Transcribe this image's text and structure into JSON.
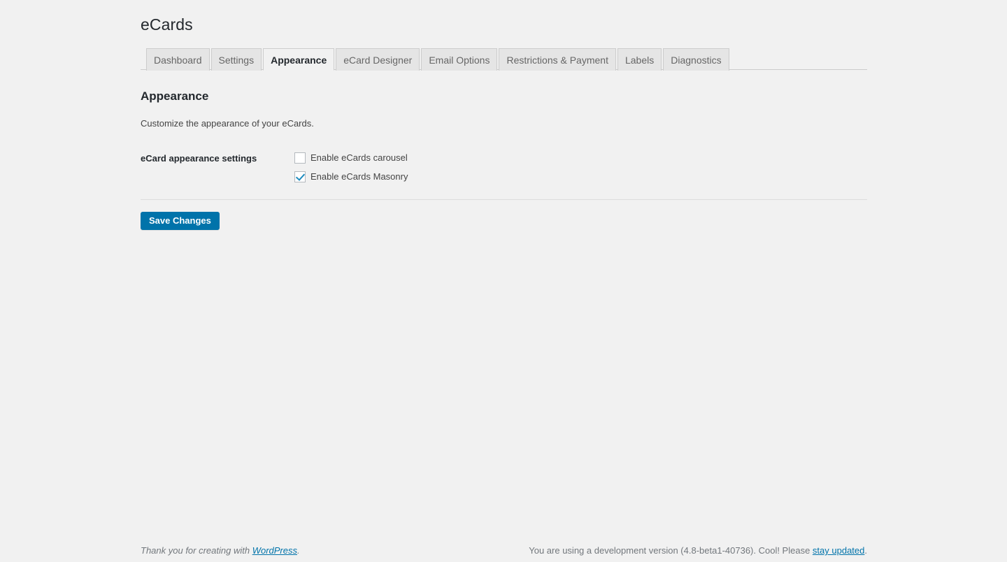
{
  "page": {
    "title": "eCards"
  },
  "tabs": [
    {
      "label": "Dashboard",
      "active": false
    },
    {
      "label": "Settings",
      "active": false
    },
    {
      "label": "Appearance",
      "active": true
    },
    {
      "label": "eCard Designer",
      "active": false
    },
    {
      "label": "Email Options",
      "active": false
    },
    {
      "label": "Restrictions & Payment",
      "active": false
    },
    {
      "label": "Labels",
      "active": false
    },
    {
      "label": "Diagnostics",
      "active": false
    }
  ],
  "section": {
    "heading": "Appearance",
    "description": "Customize the appearance of your eCards."
  },
  "settings": {
    "row_label": "eCard appearance settings",
    "checkboxes": [
      {
        "label": "Enable eCards carousel",
        "checked": false
      },
      {
        "label": "Enable eCards Masonry",
        "checked": true
      }
    ]
  },
  "submit": {
    "save_label": "Save Changes"
  },
  "footer": {
    "left_prefix": "Thank you for creating with ",
    "left_link": "WordPress",
    "left_suffix": ".",
    "right_prefix": "You are using a development version (4.8-beta1-40736). Cool! Please ",
    "right_link": "stay updated",
    "right_suffix": "."
  },
  "colors": {
    "background": "#f1f1f1",
    "accent": "#0073aa",
    "checkmark": "#1e8cbe",
    "tab_inactive_bg": "#e5e5e5",
    "border": "#cccccc",
    "text_dark": "#23282d",
    "text_muted": "#72777c"
  }
}
